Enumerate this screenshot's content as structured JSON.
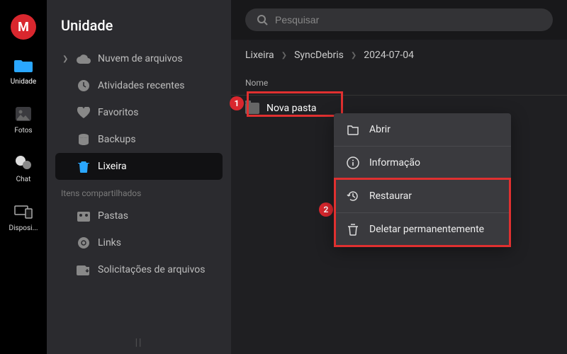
{
  "rail": {
    "items": [
      {
        "label": "Unidade"
      },
      {
        "label": "Fotos"
      },
      {
        "label": "Chat"
      },
      {
        "label": "Disposi..."
      }
    ]
  },
  "sidebar": {
    "title": "Unidade",
    "items": [
      {
        "label": "Nuvem de arquivos"
      },
      {
        "label": "Atividades recentes"
      },
      {
        "label": "Favoritos"
      },
      {
        "label": "Backups"
      },
      {
        "label": "Lixeira"
      }
    ],
    "shared_heading": "Itens compartilhados",
    "shared": [
      {
        "label": "Pastas"
      },
      {
        "label": "Links"
      },
      {
        "label": "Solicitações de arquivos"
      }
    ]
  },
  "search": {
    "placeholder": "Pesquisar"
  },
  "breadcrumbs": [
    "Lixeira",
    "SyncDebris",
    "2024-07-04"
  ],
  "table": {
    "col_name": "Nome",
    "rows": [
      {
        "name": "Nova pasta"
      }
    ]
  },
  "context_menu": {
    "items": [
      {
        "label": "Abrir"
      },
      {
        "label": "Informação"
      },
      {
        "label": "Restaurar"
      },
      {
        "label": "Deletar permanentemente"
      }
    ]
  },
  "annotations": {
    "badge1": "1",
    "badge2": "2"
  }
}
